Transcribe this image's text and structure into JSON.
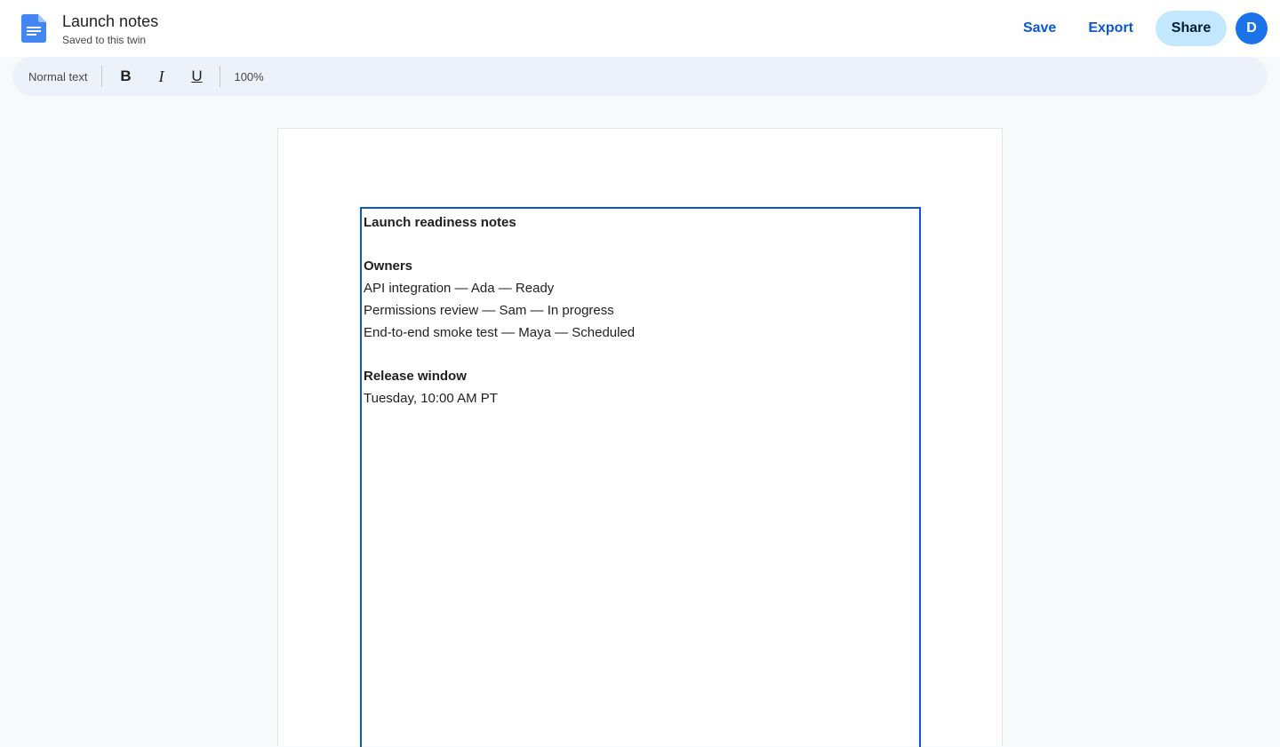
{
  "header": {
    "title": "Launch notes",
    "subtitle": "Saved to this twin",
    "save_label": "Save",
    "export_label": "Export",
    "share_label": "Share",
    "avatar_initial": "D"
  },
  "toolbar": {
    "style": "Normal text",
    "bold_label": "B",
    "italic_label": "I",
    "underline_label": "U",
    "zoom": "100%"
  },
  "document": {
    "heading": "Launch readiness notes",
    "owners_heading": "Owners",
    "owners": [
      "API integration — Ada — Ready",
      "Permissions review — Sam — In progress",
      "End-to-end smoke test — Maya — Scheduled"
    ],
    "release_heading": "Release window",
    "release_value": "Tuesday, 10:00 AM PT"
  },
  "colors": {
    "accent": "#0b57d0",
    "share_bg": "#c2e7ff",
    "toolbar_bg": "#edf2fa",
    "avatar_bg": "#1a73e8",
    "doc_icon": "#4285f4"
  },
  "icons": {
    "app": "docs-icon"
  }
}
